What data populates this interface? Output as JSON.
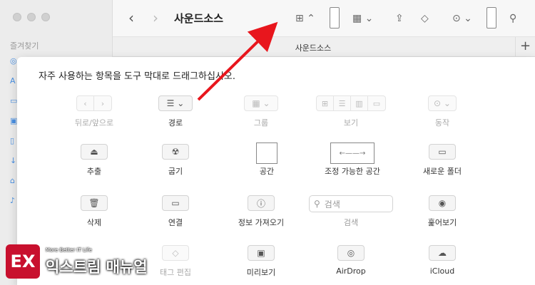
{
  "window": {
    "title": "사운드소스"
  },
  "sidebar": {
    "section_title": "즐겨찾기"
  },
  "tab": {
    "label": "사운드소스",
    "add": "+"
  },
  "sheet": {
    "title": "자주 사용하는 항목을 도구 막대로 드래그하십시오.",
    "row1": [
      {
        "label": "뒤로/앞으로",
        "dim": true
      },
      {
        "label": "경로",
        "dim": false
      },
      {
        "label": "그룹",
        "dim": true
      },
      {
        "label": "보기",
        "dim": true
      },
      {
        "label": "동작",
        "dim": true
      }
    ],
    "row2": [
      {
        "label": "추출",
        "icon": "eject-icon"
      },
      {
        "label": "굽기",
        "icon": "burn-icon"
      },
      {
        "label": "공간",
        "icon": "space-icon"
      },
      {
        "label": "조정 가능한 공간",
        "icon": "flexible-space-icon"
      },
      {
        "label": "새로운 폴더",
        "icon": "new-folder-icon"
      }
    ],
    "row3": [
      {
        "label": "삭제",
        "icon": "trash-icon"
      },
      {
        "label": "연결",
        "icon": "connect-icon"
      },
      {
        "label": "정보 가져오기",
        "icon": "info-icon"
      },
      {
        "label": "검색",
        "icon": "search-icon",
        "placeholder": "검색"
      },
      {
        "label": "훑어보기",
        "icon": "eye-icon"
      }
    ],
    "row4": [
      {
        "label": "태그 편집",
        "dim": true
      },
      {
        "label": "미리보기"
      },
      {
        "label": "AirDrop"
      },
      {
        "label": "iCloud"
      }
    ]
  },
  "logo": {
    "sub": "More Better IT Life",
    "main": "익스트림 매뉴얼",
    "mark": "EX"
  },
  "colors": {
    "arrow": "#e8161d",
    "logo": "#c8102e"
  }
}
